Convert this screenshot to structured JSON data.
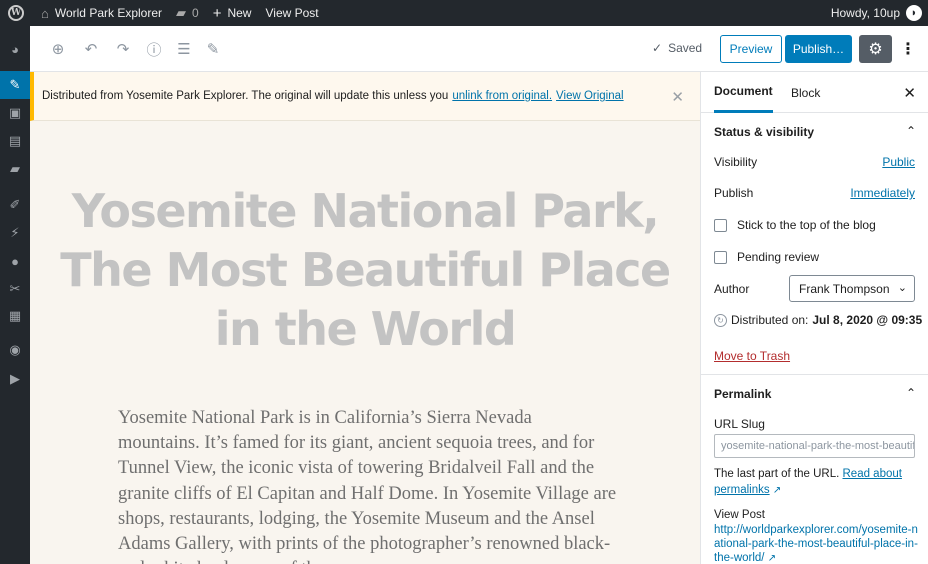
{
  "admin_bar": {
    "site_name": "World Park Explorer",
    "comments_count": "0",
    "new_label": "New",
    "view_post_label": "View Post",
    "howdy": "Howdy, 10up"
  },
  "toolbar": {
    "saved_label": "Saved",
    "preview_label": "Preview",
    "publish_label": "Publish…"
  },
  "notice": {
    "text": "Distributed from Yosemite Park Explorer. The original will update this unless you",
    "unlink_label": "unlink from original.",
    "view_original_label": "View Original"
  },
  "post": {
    "title": "Yosemite National Park, The Most Beautiful Place in the World",
    "body": "Yosemite National Park is in California’s Sierra Nevada mountains. It’s famed for its giant, ancient sequoia trees, and for Tunnel View, the iconic vista of towering Bridalveil Fall and the granite cliffs of El Capitan and Half Dome. In Yosemite Village are shops, restaurants, lodging, the Yosemite Museum and the Ansel Adams Gallery, with prints of the photographer’s renowned black-and-white landscapes of the area."
  },
  "sidebar": {
    "tabs": [
      "Document",
      "Block"
    ],
    "status_panel": {
      "title": "Status & visibility",
      "visibility_label": "Visibility",
      "visibility_value": "Public",
      "publish_label": "Publish",
      "publish_value": "Immediately",
      "sticky_label": "Stick to the top of the blog",
      "pending_label": "Pending review",
      "author_label": "Author",
      "author_value": "Frank Thompson",
      "distributed_label": "Distributed on:",
      "distributed_value": "Jul 8, 2020 @ 09:35",
      "trash_label": "Move to Trash"
    },
    "permalink_panel": {
      "title": "Permalink",
      "slug_label": "URL Slug",
      "slug_value": "yosemite-national-park-the-most-beautiful-place-in-the-world",
      "help_text": "The last part of the URL.",
      "read_about_label": "Read about permalinks",
      "view_post_label": "View Post",
      "view_post_url": "http://worldparkexplorer.com/yosemite-national-park-the-most-beautiful-place-in-the-world/"
    }
  },
  "colors": {
    "admin_bar_bg": "#23282d",
    "accent": "#007cba",
    "notice_border": "#ffb900",
    "trash": "#b32d2e"
  }
}
